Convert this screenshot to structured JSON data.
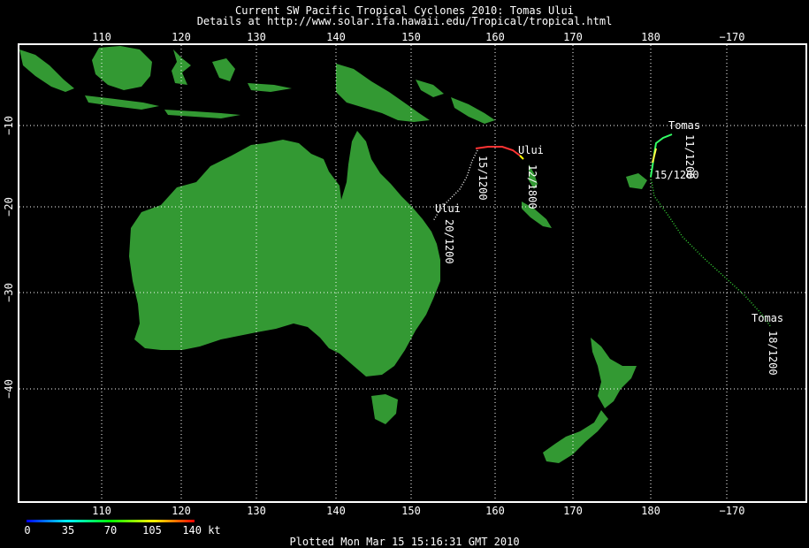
{
  "header": {
    "title": "Current SW Pacific Tropical Cyclones 2010: Tomas Ului",
    "details": "Details at http://www.solar.ifa.hawaii.edu/Tropical/tropical.html"
  },
  "map": {
    "lon_labels": [
      "110",
      "120",
      "130",
      "140",
      "150",
      "160",
      "170",
      "180",
      "−170"
    ],
    "lat_labels": [
      "−10",
      "−20",
      "−30",
      "−40"
    ],
    "land_color": "#339933",
    "grid_color": "#ffffff"
  },
  "storms": [
    {
      "name": "Ului",
      "labels": [
        "12/1800",
        "15/1200",
        "20/1200"
      ],
      "second_name": "Ului"
    },
    {
      "name": "Tomas",
      "labels": [
        "11/1200",
        "15/1200",
        "18/1200"
      ],
      "second_name": "Tomas"
    }
  ],
  "legend": {
    "ticks": [
      "0",
      "35",
      "70",
      "105",
      "140 kt"
    ],
    "colors": [
      "#0000ff",
      "#00ffff",
      "#00ff00",
      "#ffff00",
      "#ff0000"
    ]
  },
  "footer": {
    "plotted": "Plotted Mon Mar 15 15:16:31 GMT 2010"
  }
}
